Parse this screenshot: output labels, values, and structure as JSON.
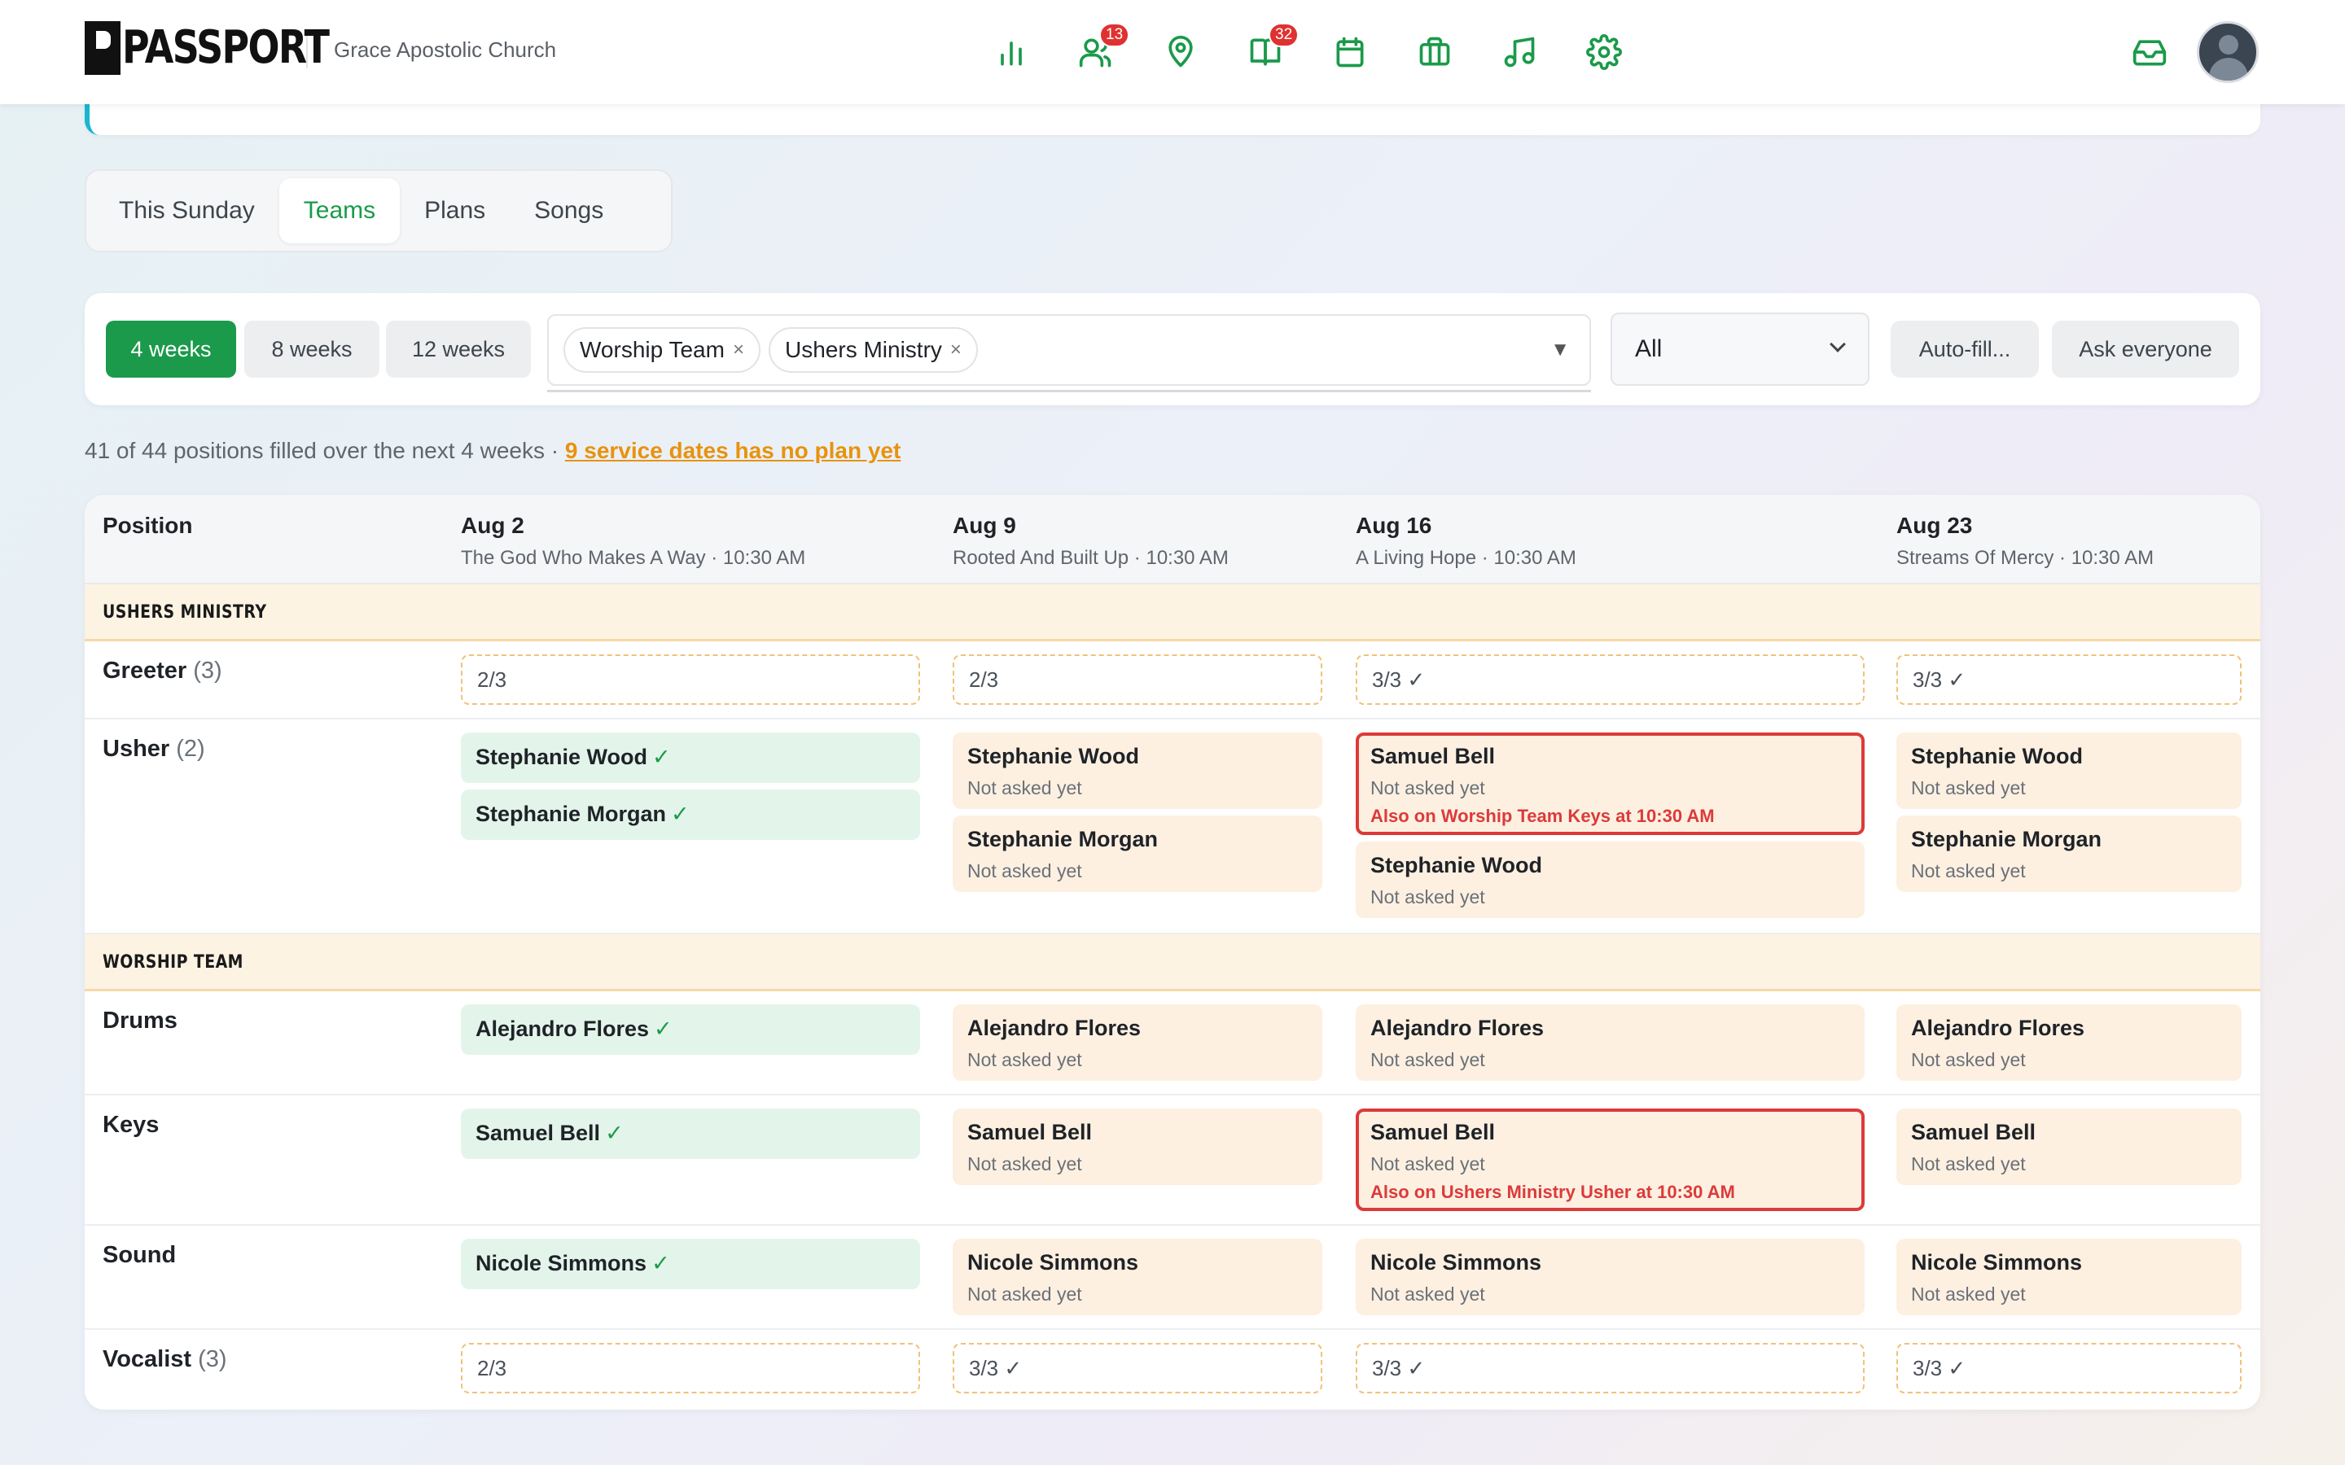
{
  "app": {
    "logo": "PASSPORT",
    "org_name": "Grace Apostolic Church"
  },
  "nav": {
    "icons": [
      {
        "name": "chart-icon"
      },
      {
        "name": "people-icon",
        "badge": "13"
      },
      {
        "name": "location-icon"
      },
      {
        "name": "book-icon",
        "badge": "32"
      },
      {
        "name": "calendar-icon"
      },
      {
        "name": "briefcase-icon"
      },
      {
        "name": "music-icon"
      },
      {
        "name": "settings-icon"
      }
    ],
    "accent": "#1a9a4a"
  },
  "tabs": [
    "This Sunday",
    "Teams",
    "Plans",
    "Songs"
  ],
  "active_tab": "Teams",
  "filters": {
    "weeks": [
      "4 weeks",
      "8 weeks",
      "12 weeks"
    ],
    "active_weeks": "4 weeks",
    "teams": [
      "Worship Team",
      "Ushers Ministry"
    ],
    "chip_remove": "×",
    "dropdown_caret": "▼",
    "status": "All",
    "autofill": "Auto-fill...",
    "ask": "Ask everyone"
  },
  "summary": {
    "text": "41 of 44 positions filled over the next 4 weeks · ",
    "link": "9 service dates has no plan yet"
  },
  "table": {
    "position_header": "Position",
    "dates": [
      {
        "date": "Aug 2",
        "sub": "The God Who Makes A Way · 10:30 AM"
      },
      {
        "date": "Aug 9",
        "sub": "Rooted And Built Up · 10:30 AM"
      },
      {
        "date": "Aug 16",
        "sub": "A Living Hope · 10:30 AM"
      },
      {
        "date": "Aug 23",
        "sub": "Streams Of Mercy · 10:30 AM"
      }
    ],
    "sections": [
      {
        "name": "USHERS MINISTRY"
      },
      {
        "name": "WORSHIP TEAM"
      }
    ],
    "check": "✓",
    "rows": {
      "greeter": {
        "label": "Greeter",
        "count": "(3)",
        "cells": [
          "2/3",
          "2/3",
          "3/3 ✓",
          "3/3 ✓"
        ]
      },
      "usher": {
        "label": "Usher",
        "count": "(2)"
      },
      "drums": {
        "label": "Drums"
      },
      "keys": {
        "label": "Keys"
      },
      "sound": {
        "label": "Sound"
      },
      "vocalist": {
        "label": "Vocalist",
        "count": "(3)",
        "cells": [
          "2/3",
          "3/3 ✓",
          "3/3 ✓",
          "3/3 ✓"
        ]
      }
    },
    "people": {
      "stephanie_wood": "Stephanie Wood",
      "stephanie_morgan": "Stephanie Morgan",
      "samuel_bell": "Samuel Bell",
      "alejandro_flores": "Alejandro Flores",
      "nicole_simmons": "Nicole Simmons"
    },
    "status_not_asked": "Not asked yet",
    "conflicts": {
      "usher_aug16": "Also on Worship Team Keys at 10:30 AM",
      "keys_aug16": "Also on Ushers Ministry Usher at 10:30 AM"
    }
  }
}
